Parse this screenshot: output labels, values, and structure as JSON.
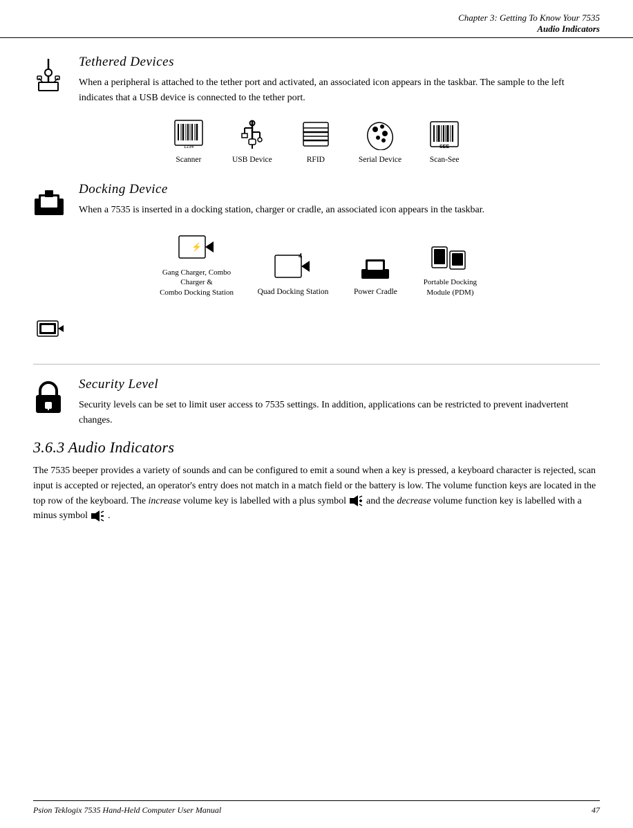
{
  "header": {
    "line1": "Chapter  3:  Getting To Know Your 7535",
    "line2": "Audio Indicators"
  },
  "sections": {
    "tethered": {
      "title": "Tethered  Devices",
      "text": "When a peripheral is attached to the tether port and activated, an associated icon appears in the taskbar. The sample to the left indicates that a USB device is connected to the tether port.",
      "icons": [
        {
          "label": "Scanner"
        },
        {
          "label": "USB  Device"
        },
        {
          "label": "RFID"
        },
        {
          "label": "Serial  Device"
        },
        {
          "label": "Scan-See"
        }
      ]
    },
    "docking": {
      "title": "Docking  Device",
      "text": "When a 7535 is inserted in a docking station, charger or cradle, an associated icon appears in the taskbar.",
      "icons": [
        {
          "label": "Gang  Charger, Combo  Charger  &\nCombo  Docking  Station"
        },
        {
          "label": "Quad  Docking  Station"
        },
        {
          "label": "Power  Cradle"
        },
        {
          "label": "Portable  Docking\nModule  (PDM)"
        }
      ]
    },
    "security": {
      "title": "Security  Level",
      "text": "Security levels can be set to limit user access to 7535 settings. In addition, applications can be restricted to prevent inadvertent changes."
    },
    "audio": {
      "subtitle": "3.6.3   Audio  Indicators",
      "text1": "The 7535 beeper provides a variety of sounds and can be configured to emit a sound when a key is pressed, a keyboard character is rejected, scan input is accepted or rejected, an operator's entry does not match in a match field or the battery is low. The volume function keys are located in the top row of the keyboard. The ",
      "italic1": "increase",
      "text2": " volume key is labelled with a plus symbol ",
      "text3": " and the ",
      "italic2": "decrease",
      "text4": " volume function key is labelled with a minus symbol ",
      "text5": "."
    }
  },
  "footer": {
    "left": "Psion Teklogix 7535 Hand-Held Computer User Manual",
    "right": "47"
  }
}
